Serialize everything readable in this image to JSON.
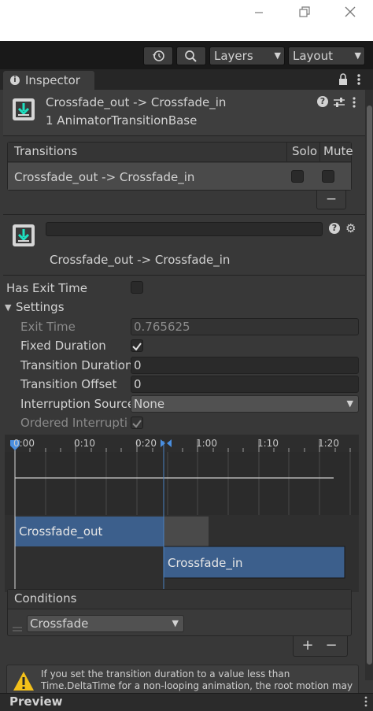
{
  "toolbar": {
    "layers_label": "Layers",
    "layout_label": "Layout"
  },
  "inspector": {
    "tab_label": "Inspector",
    "header_title": "Crossfade_out -> Crossfade_in",
    "header_subtitle": "1 AnimatorTransitionBase"
  },
  "transitions": {
    "header": "Transitions",
    "solo": "Solo",
    "mute": "Mute",
    "row_label": "Crossfade_out -> Crossfade_in",
    "remove": "−"
  },
  "transition": {
    "name": "Crossfade_out -> Crossfade_in",
    "has_exit_time_label": "Has Exit Time",
    "settings_label": "Settings",
    "exit_time_label": "Exit Time",
    "exit_time_value": "0.765625",
    "fixed_duration_label": "Fixed Duration",
    "transition_duration_label": "Transition Duration",
    "transition_duration_value": "0",
    "transition_offset_label": "Transition Offset",
    "transition_offset_value": "0",
    "interruption_source_label": "Interruption Source",
    "interruption_source_value": "None",
    "ordered_interruption_label": "Ordered Interruptio"
  },
  "timeline": {
    "ticks": [
      "0:00",
      "0:10",
      "0:20",
      "1:00",
      "1:10",
      "1:20"
    ],
    "clip_out": "Crossfade_out",
    "clip_in": "Crossfade_in"
  },
  "conditions": {
    "header": "Conditions",
    "parameter": "Crossfade",
    "add": "+",
    "remove": "−"
  },
  "warning": {
    "line1": "If you set the transition duration to a value less than",
    "line2": "Time.DeltaTime for a non-looping animation, the root motion may"
  },
  "preview": {
    "label": "Preview"
  }
}
